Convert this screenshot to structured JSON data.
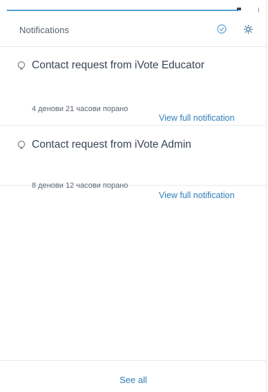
{
  "header": {
    "title": "Notifications",
    "mark_all_read_icon": "check-circle-icon",
    "settings_icon": "gear-icon"
  },
  "notifications": [
    {
      "icon": "lightbulb-icon",
      "title": "Contact request from iVote Educator",
      "time": "4 денови 21 часови порано",
      "link": "View full notification"
    },
    {
      "icon": "lightbulb-icon",
      "title": "Contact request from iVote Admin",
      "time": "8 денови 12 часови порано",
      "link": "View full notification"
    }
  ],
  "footer": {
    "see_all": "See all"
  },
  "colors": {
    "accent": "#4f9fd4",
    "link": "#2f7db8",
    "divider": "#e6e9ed"
  }
}
